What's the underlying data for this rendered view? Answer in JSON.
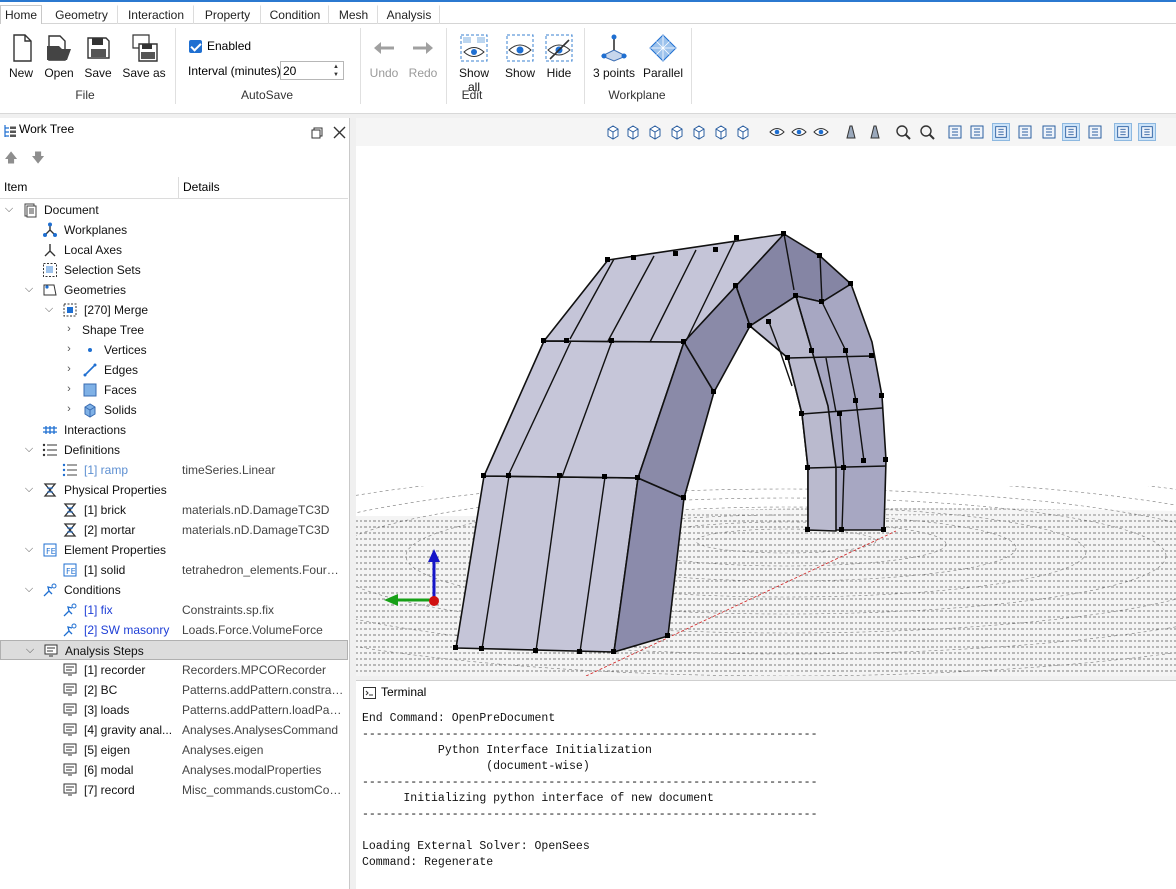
{
  "ribbon": {
    "tabs": [
      "Home",
      "Geometry",
      "Interaction",
      "Property",
      "Condition",
      "Mesh",
      "Analysis"
    ],
    "active_tab": "Home",
    "file": {
      "new": "New",
      "open": "Open",
      "save": "Save",
      "save_as": "Save as",
      "group": "File"
    },
    "autosave": {
      "enabled_label": "Enabled",
      "enabled": true,
      "interval_label": "Interval (minutes)",
      "interval_value": "20",
      "group": "AutoSave"
    },
    "edit": {
      "undo": "Undo",
      "redo": "Redo",
      "show_all": "Show all",
      "show": "Show",
      "hide": "Hide",
      "group": "Edit"
    },
    "workplane": {
      "three_points": "3 points",
      "parallel": "Parallel",
      "group": "Workplane"
    }
  },
  "work_tree": {
    "title": "Work Tree",
    "col_item": "Item",
    "col_details": "Details",
    "rows": [
      {
        "label": "Document",
        "details": "",
        "color": "",
        "icon": "document-icon",
        "expander": "v"
      },
      {
        "label": "Workplanes",
        "details": "",
        "color": "",
        "icon": "workplane-icon",
        "expander": ""
      },
      {
        "label": "Local Axes",
        "details": "",
        "color": "",
        "icon": "axes-icon",
        "expander": ""
      },
      {
        "label": "Selection Sets",
        "details": "",
        "color": "",
        "icon": "selection-set-icon",
        "expander": ""
      },
      {
        "label": "Geometries",
        "details": "",
        "color": "",
        "icon": "geometry-icon",
        "expander": "v"
      },
      {
        "label": "[270] Merge",
        "details": "",
        "color": "",
        "icon": "merge-icon",
        "expander": "v"
      },
      {
        "label": "Shape Tree",
        "details": "",
        "color": "",
        "icon": "",
        "expander": ">"
      },
      {
        "label": "Vertices",
        "details": "",
        "color": "",
        "icon": "vertex-icon",
        "expander": ">"
      },
      {
        "label": "Edges",
        "details": "",
        "color": "",
        "icon": "edge-icon",
        "expander": ">"
      },
      {
        "label": "Faces",
        "details": "",
        "color": "",
        "icon": "face-icon",
        "expander": ">"
      },
      {
        "label": "Solids",
        "details": "",
        "color": "",
        "icon": "solid-icon",
        "expander": ">"
      },
      {
        "label": "Interactions",
        "details": "",
        "color": "",
        "icon": "interaction-icon",
        "expander": ""
      },
      {
        "label": "Definitions",
        "details": "",
        "color": "",
        "icon": "definitions-icon",
        "expander": "v"
      },
      {
        "label": "[1] ramp",
        "details": "timeSeries.Linear",
        "color": "lightblue",
        "icon": "list-icon",
        "expander": ""
      },
      {
        "label": "Physical Properties",
        "details": "",
        "color": "",
        "icon": "physical-property-icon",
        "expander": "v"
      },
      {
        "label": "[1] brick",
        "details": "materials.nD.DamageTC3D",
        "color": "",
        "icon": "physical-property-icon",
        "expander": ""
      },
      {
        "label": "[2] mortar",
        "details": "materials.nD.DamageTC3D",
        "color": "",
        "icon": "physical-property-icon",
        "expander": ""
      },
      {
        "label": "Element Properties",
        "details": "",
        "color": "",
        "icon": "element-property-icon",
        "expander": "v"
      },
      {
        "label": "[1] solid",
        "details": "tetrahedron_elements.FourNodeTetrahedron",
        "color": "",
        "icon": "element-property-icon",
        "expander": ""
      },
      {
        "label": "Conditions",
        "details": "",
        "color": "",
        "icon": "condition-icon",
        "expander": "v"
      },
      {
        "label": "[1] fix",
        "details": "Constraints.sp.fix",
        "color": "blue",
        "icon": "condition-icon",
        "expander": ""
      },
      {
        "label": "[2] SW masonry",
        "details": "Loads.Force.VolumeForce",
        "color": "blue",
        "icon": "condition-icon",
        "expander": ""
      },
      {
        "label": "Analysis Steps",
        "details": "",
        "color": "",
        "icon": "analysis-step-icon",
        "expander": "v"
      },
      {
        "label": "[1] recorder",
        "details": "Recorders.MPCORecorder",
        "color": "",
        "icon": "analysis-step-icon",
        "expander": ""
      },
      {
        "label": "[2] BC",
        "details": "Patterns.addPattern.constraintPattern",
        "color": "",
        "icon": "analysis-step-icon",
        "expander": ""
      },
      {
        "label": "[3] loads",
        "details": "Patterns.addPattern.loadPattern",
        "color": "",
        "icon": "analysis-step-icon",
        "expander": ""
      },
      {
        "label": "[4] gravity anal...",
        "details": "Analyses.AnalysesCommand",
        "color": "",
        "icon": "analysis-step-icon",
        "expander": ""
      },
      {
        "label": "[5] eigen",
        "details": "Analyses.eigen",
        "color": "",
        "icon": "analysis-step-icon",
        "expander": ""
      },
      {
        "label": "[6] modal",
        "details": "Analyses.modalProperties",
        "color": "",
        "icon": "analysis-step-icon",
        "expander": ""
      },
      {
        "label": "[7] record",
        "details": "Misc_commands.customCommand",
        "color": "",
        "icon": "analysis-step-icon",
        "expander": ""
      }
    ],
    "selected_row": "Analysis Steps"
  },
  "terminal": {
    "title": "Terminal",
    "lines": [
      "End Command: OpenPreDocument",
      "------------------------------------------------------------------",
      "           Python Interface Initialization",
      "                  (document-wise)",
      "------------------------------------------------------------------",
      "      Initializing python interface of new document",
      "------------------------------------------------------------------",
      "",
      "Loading External Solver: OpenSees",
      "Command: Regenerate"
    ]
  },
  "colors": {
    "accent": "#2b79d0",
    "face_light": "#c4c4d6",
    "face_dark": "#8b8baa",
    "axis_x": "#1aa01a",
    "axis_y": "#1010d0",
    "origin": "#d01010"
  }
}
